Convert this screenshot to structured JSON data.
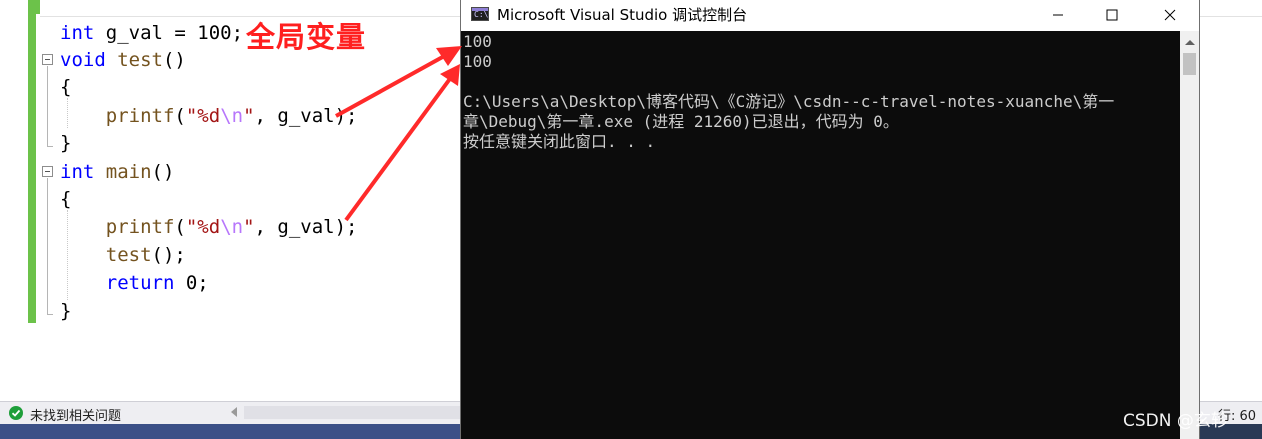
{
  "editor": {
    "lines": [
      {
        "parts": [
          {
            "t": "int",
            "c": "kw"
          },
          {
            "t": " g_val = 100;",
            "c": "id"
          }
        ]
      },
      {
        "parts": [
          {
            "t": "void",
            "c": "kw"
          },
          {
            "t": " ",
            "c": "id"
          },
          {
            "t": "test",
            "c": "fn"
          },
          {
            "t": "()",
            "c": "id"
          }
        ]
      },
      {
        "parts": [
          {
            "t": "{",
            "c": "id"
          }
        ]
      },
      {
        "parts": [
          {
            "t": "    ",
            "c": "id"
          },
          {
            "t": "printf",
            "c": "fn"
          },
          {
            "t": "(",
            "c": "id"
          },
          {
            "t": "\"%d",
            "c": "str"
          },
          {
            "t": "\\n",
            "c": "esc"
          },
          {
            "t": "\"",
            "c": "str"
          },
          {
            "t": ", g_val);",
            "c": "id"
          }
        ]
      },
      {
        "parts": [
          {
            "t": "}",
            "c": "id"
          }
        ]
      },
      {
        "parts": [
          {
            "t": "int",
            "c": "kw"
          },
          {
            "t": " ",
            "c": "id"
          },
          {
            "t": "main",
            "c": "fn"
          },
          {
            "t": "()",
            "c": "id"
          }
        ]
      },
      {
        "parts": [
          {
            "t": "{",
            "c": "id"
          }
        ]
      },
      {
        "parts": [
          {
            "t": "    ",
            "c": "id"
          },
          {
            "t": "printf",
            "c": "fn"
          },
          {
            "t": "(",
            "c": "id"
          },
          {
            "t": "\"%d",
            "c": "str"
          },
          {
            "t": "\\n",
            "c": "esc"
          },
          {
            "t": "\"",
            "c": "str"
          },
          {
            "t": ", g_val);",
            "c": "id"
          }
        ]
      },
      {
        "parts": [
          {
            "t": "    ",
            "c": "id"
          },
          {
            "t": "test",
            "c": "fn"
          },
          {
            "t": "();",
            "c": "id"
          }
        ]
      },
      {
        "parts": [
          {
            "t": "    ",
            "c": "id"
          },
          {
            "t": "return",
            "c": "kw"
          },
          {
            "t": " 0;",
            "c": "id"
          }
        ]
      },
      {
        "parts": [
          {
            "t": "}",
            "c": "id"
          }
        ]
      }
    ]
  },
  "annotation": {
    "text": "全局变量",
    "color": "#ff1f1f"
  },
  "status_bar": {
    "issues_text": "未找到相关问题",
    "line_indicator": "行: 60"
  },
  "console": {
    "title": "Microsoft Visual Studio 调试控制台",
    "icon_label": "C:\\",
    "lines": [
      "100",
      "100",
      "",
      "C:\\Users\\a\\Desktop\\博客代码\\《C游记》\\csdn--c-travel-notes-xuanche\\第一",
      "章\\Debug\\第一章.exe (进程 21260)已退出，代码为 0。",
      "按任意键关闭此窗口. . ."
    ],
    "buttons": [
      "minimize-icon",
      "maximize-icon",
      "close-icon"
    ]
  },
  "watermark": "CSDN @玄轸",
  "colors": {
    "keyword": "#0000ff",
    "function": "#74531f",
    "string": "#a31515",
    "escape": "#b776fb",
    "change_margin": "#6cc24a",
    "console_bg": "#0c0c0c",
    "console_text": "#cccccc"
  }
}
